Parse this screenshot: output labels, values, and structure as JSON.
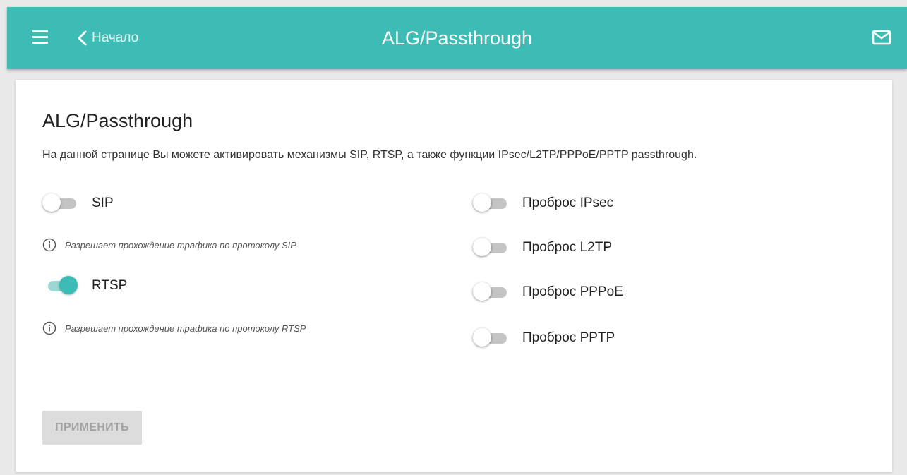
{
  "header": {
    "back_label": "Начало",
    "title": "ALG/Passthrough",
    "menu_icon": "hamburger-icon",
    "back_icon": "chevron-left-icon",
    "mail_icon": "mail-icon"
  },
  "page": {
    "title": "ALG/Passthrough",
    "description": "На данной странице Вы можете активировать механизмы SIP, RTSP, а также функции IPsec/L2TP/PPPoE/PPTP passthrough."
  },
  "left_toggles": [
    {
      "label": "SIP",
      "enabled": false,
      "hint": "Разрешает прохождение трафика по протоколу SIP"
    },
    {
      "label": "RTSP",
      "enabled": true,
      "hint": "Разрешает прохождение трафика по протоколу RTSP"
    }
  ],
  "right_toggles": [
    {
      "label": "Проброс IPsec",
      "enabled": false
    },
    {
      "label": "Проброс L2TP",
      "enabled": false
    },
    {
      "label": "Проброс PPPoE",
      "enabled": false
    },
    {
      "label": "Проброс PPTP",
      "enabled": false
    }
  ],
  "apply_button": {
    "label": "ПРИМЕНИТЬ",
    "disabled": true
  },
  "colors": {
    "accent": "#3dbcb5",
    "accent_light": "#9bd8d4",
    "background": "#e9e9e9"
  }
}
